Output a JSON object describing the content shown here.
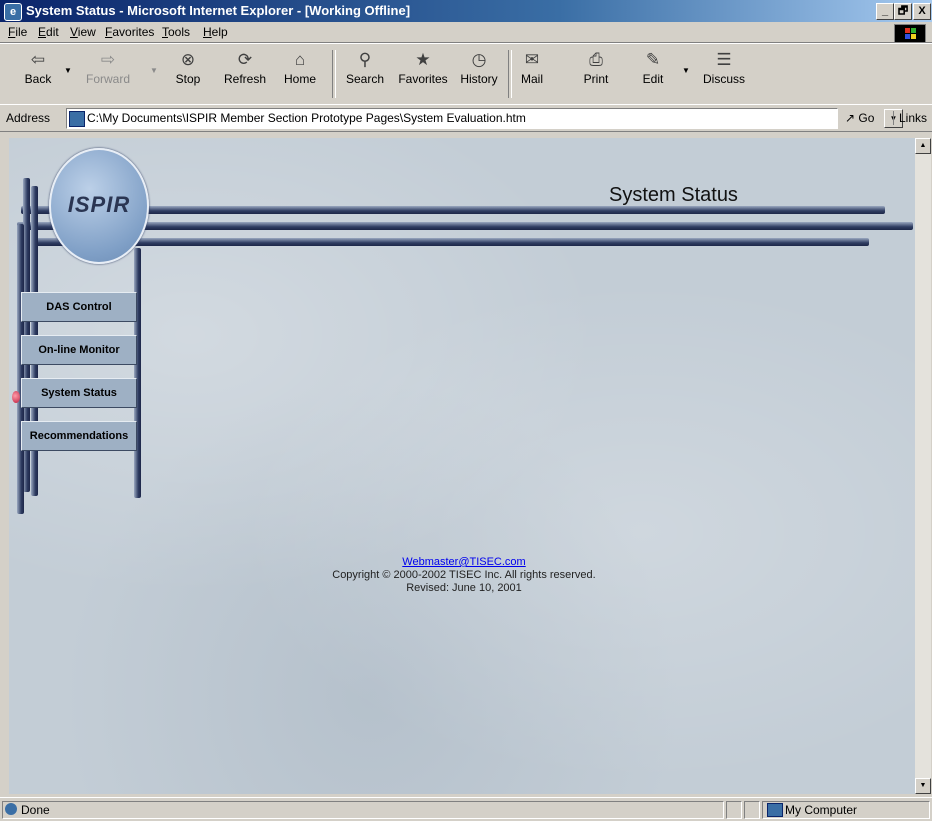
{
  "window": {
    "title": "System Status - Microsoft Internet Explorer - [Working Offline]",
    "controls": [
      "_",
      "🗗",
      "X"
    ]
  },
  "menu": [
    "File",
    "Edit",
    "View",
    "Favorites",
    "Tools",
    "Help"
  ],
  "toolbar": {
    "back": "Back",
    "forward": "Forward",
    "stop": "Stop",
    "refresh": "Refresh",
    "home": "Home",
    "search": "Search",
    "favorites": "Favorites",
    "history": "History",
    "mail": "Mail",
    "print": "Print",
    "edit": "Edit",
    "discuss": "Discuss"
  },
  "address": {
    "label": "Address",
    "value": "C:\\My Documents\\ISPIR Member Section Prototype Pages\\System Evaluation.htm",
    "go": "Go",
    "links": "Links"
  },
  "page": {
    "logo_text": "ISPIR",
    "title": "System Status",
    "nav": [
      "DAS Control",
      "On-line Monitor",
      "System Status",
      "Recommendations"
    ],
    "active_nav": "System Status",
    "footer": {
      "email": "Webmaster@TISEC.com",
      "copyright": "Copyright © 2000-2002 TISEC Inc.  All rights reserved.",
      "revised": "Revised: June 10, 2001"
    }
  },
  "status": {
    "text": "Done",
    "zone": "My Computer"
  }
}
